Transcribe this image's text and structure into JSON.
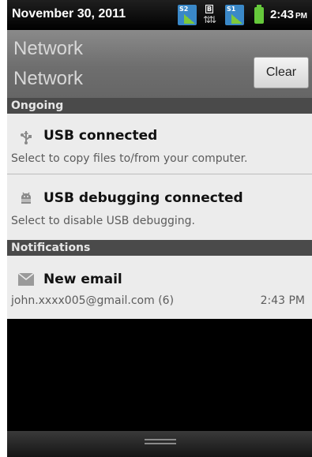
{
  "status_bar": {
    "date": "November 30, 2011",
    "time": "2:43",
    "ampm": "PM",
    "icons": [
      {
        "name": "signal-slot-2-icon",
        "label": "S2"
      },
      {
        "name": "data-sync-icon",
        "label": "B"
      },
      {
        "name": "signal-slot-1-icon",
        "label": "S1"
      },
      {
        "name": "battery-icon"
      }
    ]
  },
  "header": {
    "operator_line1": "Network",
    "operator_line2": "Network",
    "clear_label": "Clear"
  },
  "sections": {
    "ongoing": "Ongoing",
    "notifications": "Notifications"
  },
  "ongoing": [
    {
      "icon": "usb-icon",
      "title": "USB connected",
      "subtitle": "Select to copy files to/from your computer."
    },
    {
      "icon": "android-debug-icon",
      "title": "USB debugging connected",
      "subtitle": "Select to disable USB debugging."
    }
  ],
  "notifications": [
    {
      "icon": "email-icon",
      "title": "New email",
      "subtitle": "john.xxxx005@gmail.com (6)",
      "time": "2:43 PM"
    }
  ],
  "colors": {
    "status_background": "#000000",
    "header_background": "#7a7a7a",
    "section_background": "#4a4a4a",
    "item_background": "#ececec",
    "battery": "#65c83b"
  }
}
